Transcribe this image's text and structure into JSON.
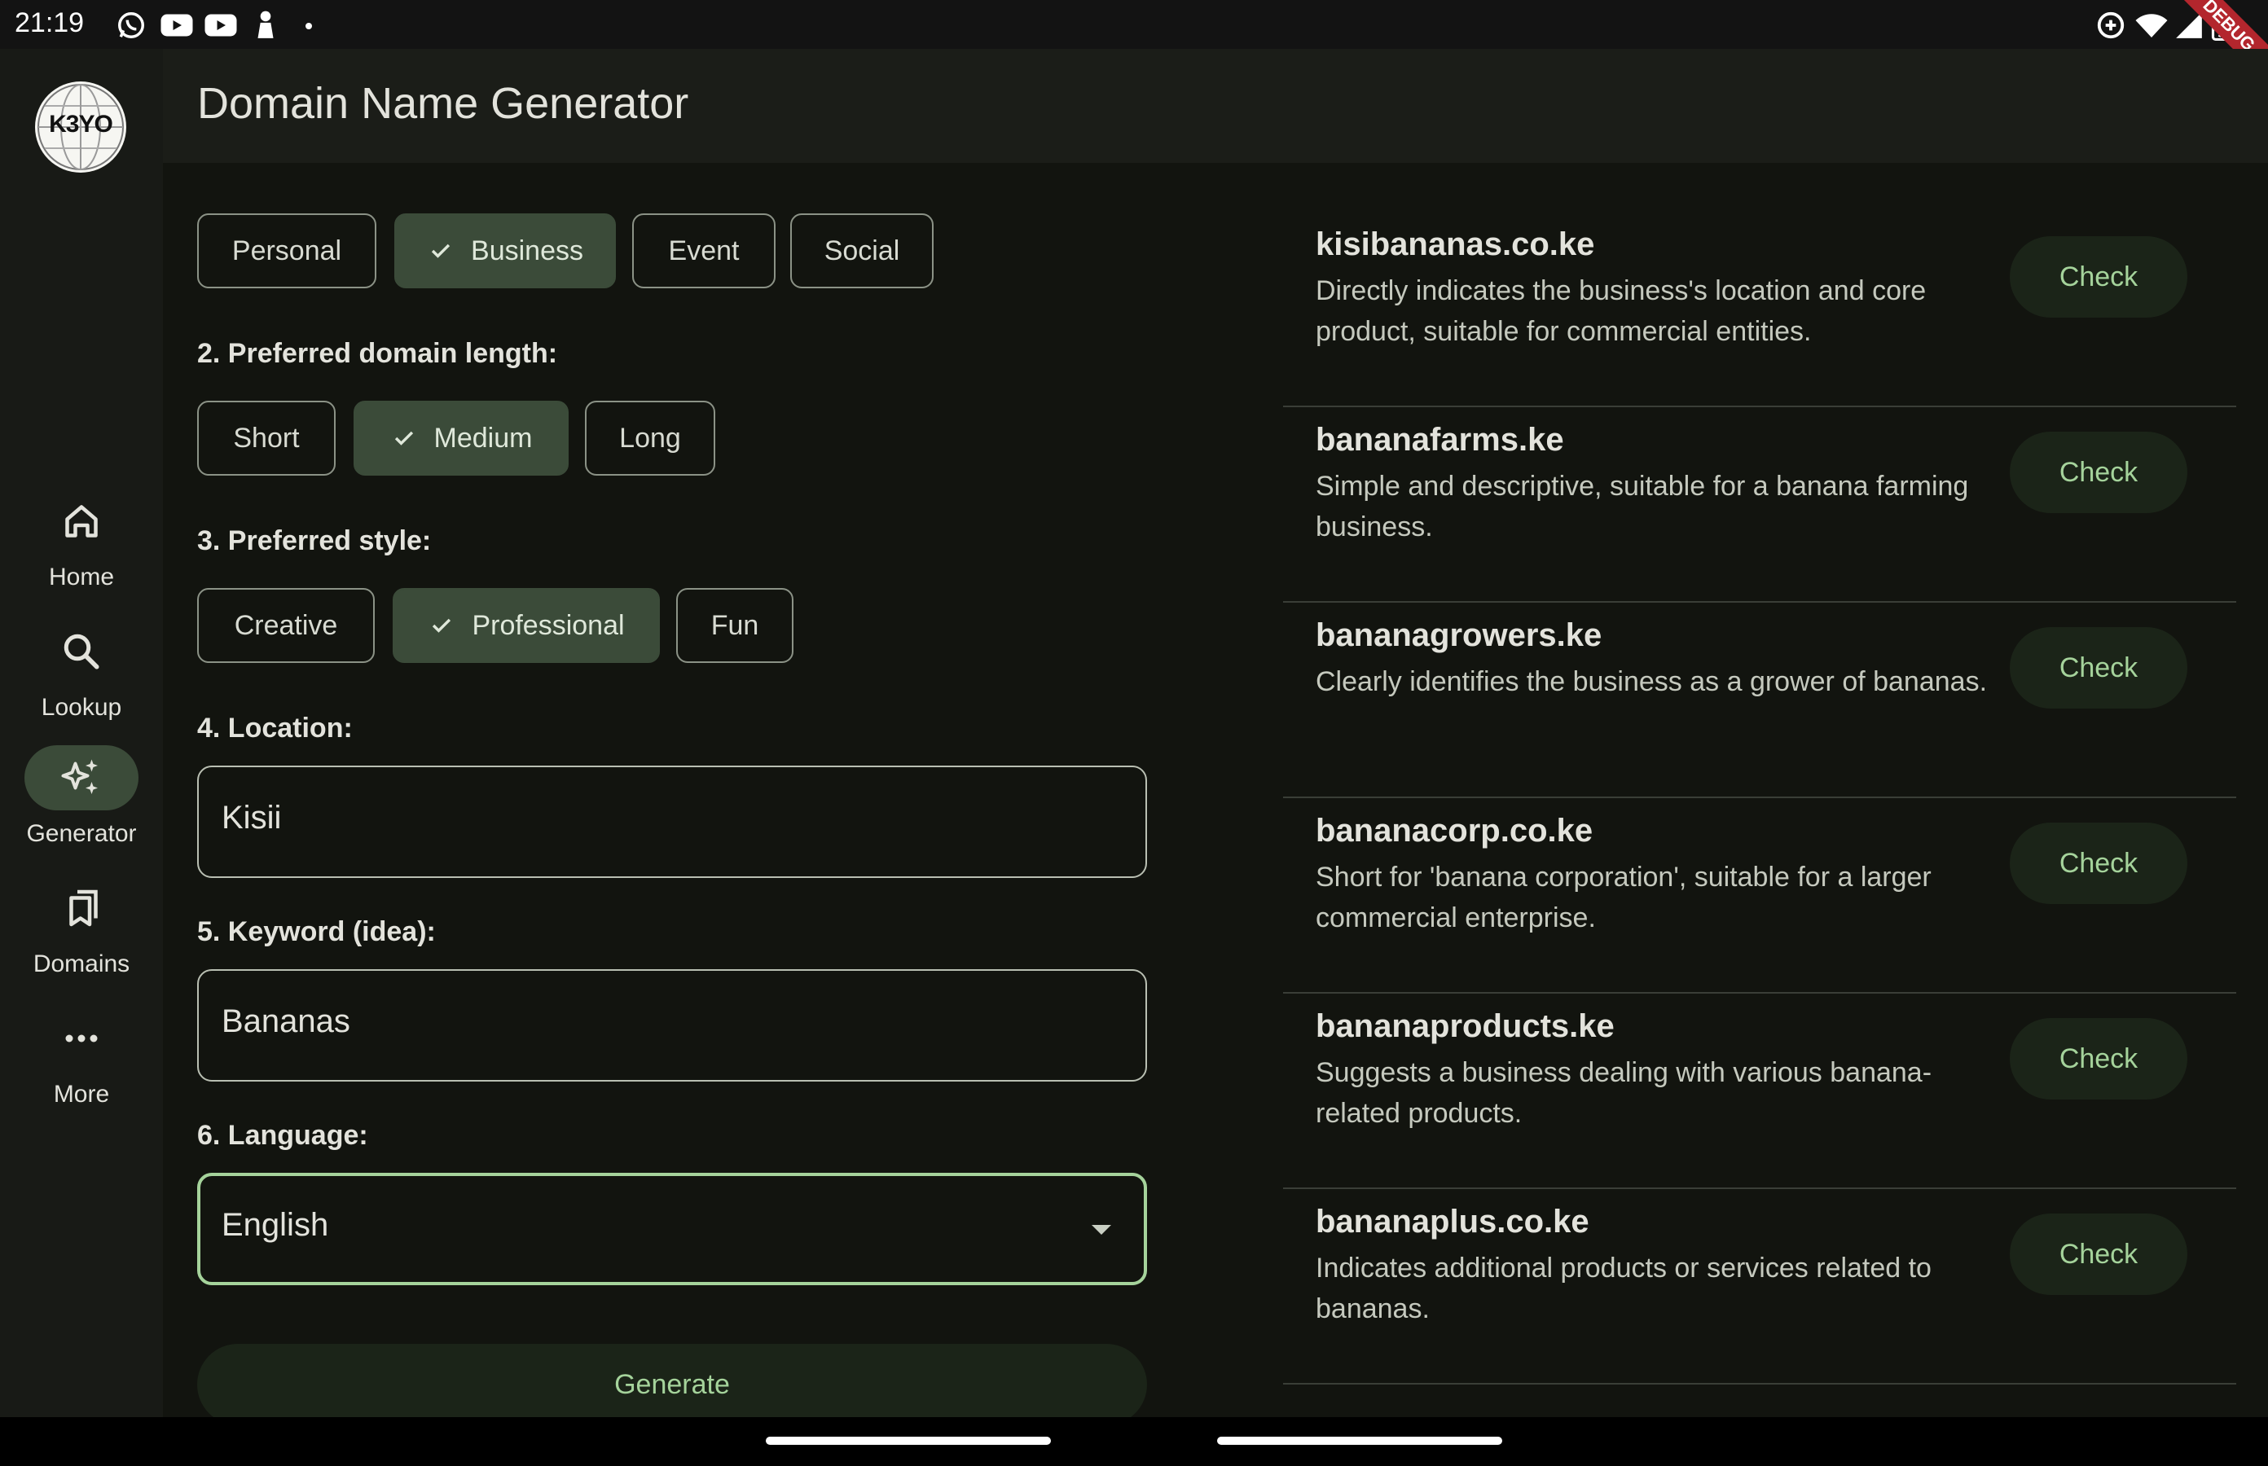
{
  "status_bar": {
    "time": "21:19",
    "debug_label": "DEBUG"
  },
  "app": {
    "title": "Domain Name Generator",
    "logo_text": "K3YO",
    "nav": [
      {
        "label": "Home",
        "icon": "home-icon"
      },
      {
        "label": "Lookup",
        "icon": "search-icon"
      },
      {
        "label": "Generator",
        "icon": "sparkle-icon",
        "active": true
      },
      {
        "label": "Domains",
        "icon": "bookmarks-icon"
      },
      {
        "label": "More",
        "icon": "more-icon"
      }
    ]
  },
  "form": {
    "purpose_chips": [
      {
        "label": "Personal",
        "selected": false
      },
      {
        "label": "Business",
        "selected": true
      },
      {
        "label": "Event",
        "selected": false
      },
      {
        "label": "Social",
        "selected": false
      }
    ],
    "length_label": "2. Preferred domain length:",
    "length_chips": [
      {
        "label": "Short",
        "selected": false
      },
      {
        "label": "Medium",
        "selected": true
      },
      {
        "label": "Long",
        "selected": false
      }
    ],
    "style_label": "3. Preferred style:",
    "style_chips": [
      {
        "label": "Creative",
        "selected": false
      },
      {
        "label": "Professional",
        "selected": true
      },
      {
        "label": "Fun",
        "selected": false
      }
    ],
    "location_label": "4. Location:",
    "location_value": "Kisii",
    "keyword_label": "5. Keyword (idea):",
    "keyword_value": "Bananas",
    "language_label": "6. Language:",
    "language_value": "English",
    "generate_label": "Generate"
  },
  "results": [
    {
      "domain": "kisibananas.co.ke",
      "description": "Directly indicates the business's location and core product, suitable for commercial entities.",
      "button": "Check"
    },
    {
      "domain": "bananafarms.ke",
      "description": "Simple and descriptive, suitable for a banana farming business.",
      "button": "Check"
    },
    {
      "domain": "bananagrowers.ke",
      "description": "Clearly identifies the business as a grower of bananas.",
      "button": "Check"
    },
    {
      "domain": "bananacorp.co.ke",
      "description": "Short for 'banana corporation', suitable for a larger commercial enterprise.",
      "button": "Check"
    },
    {
      "domain": "bananaproducts.ke",
      "description": "Suggests a business dealing with various banana-related products.",
      "button": "Check"
    },
    {
      "domain": "bananaplus.co.ke",
      "description": "Indicates additional products or services related to bananas.",
      "button": "Check"
    }
  ]
}
